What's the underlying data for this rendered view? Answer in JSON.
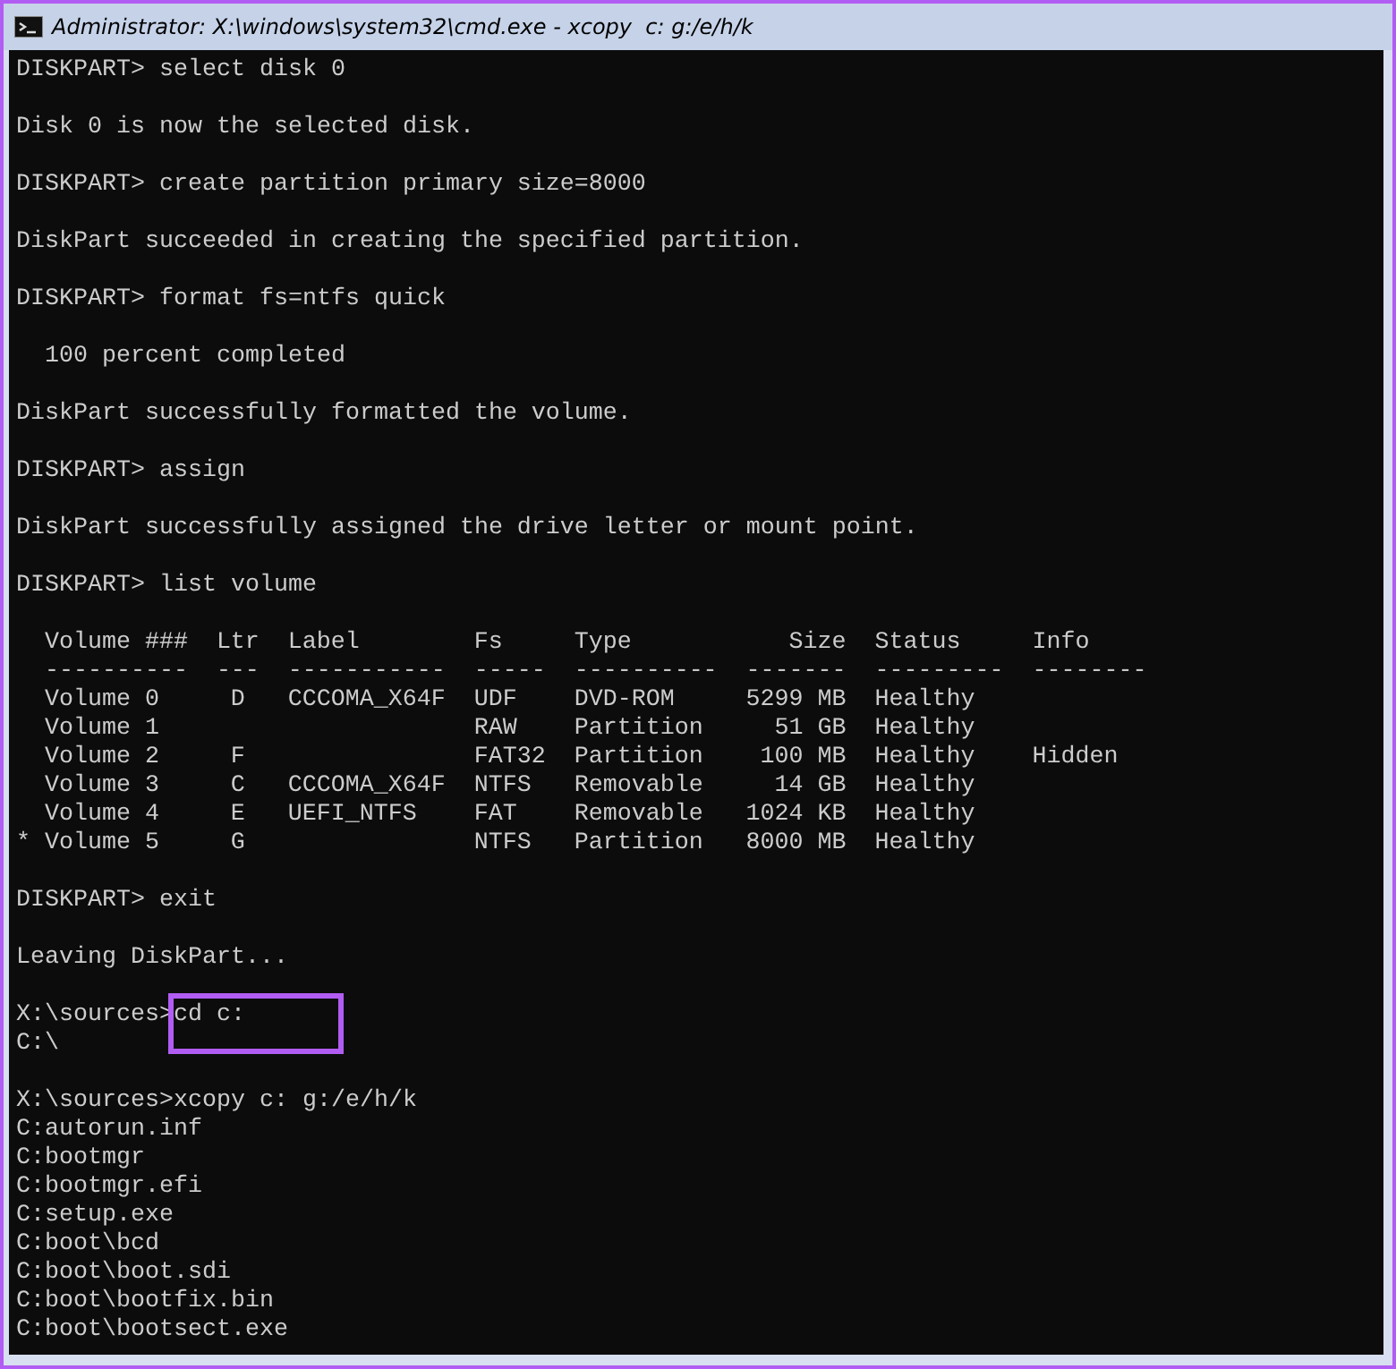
{
  "window": {
    "title": "Administrator: X:\\windows\\system32\\cmd.exe - xcopy  c: g:/e/h/k"
  },
  "console": {
    "blocks": [
      {
        "kind": "text",
        "lines": [
          {
            "text": "DISKPART> select disk 0"
          }
        ]
      },
      {
        "kind": "text",
        "lines": [
          {
            "text": "Disk 0 is now the selected disk."
          }
        ]
      },
      {
        "kind": "text",
        "lines": [
          {
            "text": "DISKPART> create partition primary size=8000"
          }
        ]
      },
      {
        "kind": "text",
        "lines": [
          {
            "text": "DiskPart succeeded in creating the specified partition."
          }
        ]
      },
      {
        "kind": "text",
        "lines": [
          {
            "text": "DISKPART> format fs=ntfs quick"
          }
        ]
      },
      {
        "kind": "text",
        "lines": [
          {
            "text": "  100 percent completed"
          }
        ]
      },
      {
        "kind": "text",
        "lines": [
          {
            "text": "DiskPart successfully formatted the volume."
          }
        ]
      },
      {
        "kind": "text",
        "lines": [
          {
            "text": "DISKPART> assign"
          }
        ]
      },
      {
        "kind": "text",
        "lines": [
          {
            "text": "DiskPart successfully assigned the drive letter or mount point."
          }
        ]
      },
      {
        "kind": "text",
        "lines": [
          {
            "text": "DISKPART> list volume"
          }
        ]
      },
      {
        "kind": "table",
        "columns": [
          "Volume ###",
          "Ltr",
          "Label",
          "Fs",
          "Type",
          "Size",
          "Status",
          "Info"
        ],
        "separators": [
          "----------",
          "---",
          "-----------",
          "-----",
          "----------",
          "-------",
          "---------",
          "--------"
        ],
        "rows": [
          {
            "marker": null,
            "cells": [
              "Volume 0",
              "D",
              "CCCOMA_X64F",
              "UDF",
              "DVD-ROM",
              "5299 MB",
              "Healthy",
              null
            ]
          },
          {
            "marker": null,
            "cells": [
              "Volume 1",
              null,
              null,
              "RAW",
              "Partition",
              "51 GB",
              "Healthy",
              null
            ]
          },
          {
            "marker": null,
            "cells": [
              "Volume 2",
              "F",
              null,
              "FAT32",
              "Partition",
              "100 MB",
              "Healthy",
              "Hidden"
            ]
          },
          {
            "marker": null,
            "cells": [
              "Volume 3",
              "C",
              "CCCOMA_X64F",
              "NTFS",
              "Removable",
              "14 GB",
              "Healthy",
              null
            ]
          },
          {
            "marker": null,
            "cells": [
              "Volume 4",
              "E",
              "UEFI_NTFS",
              "FAT",
              "Removable",
              "1024 KB",
              "Healthy",
              null
            ]
          },
          {
            "marker": "*",
            "cells": [
              "Volume 5",
              "G",
              null,
              "NTFS",
              "Partition",
              "8000 MB",
              "Healthy",
              null
            ]
          }
        ]
      },
      {
        "kind": "text",
        "lines": [
          {
            "text": "DISKPART> exit"
          }
        ]
      },
      {
        "kind": "text",
        "lines": [
          {
            "text": "Leaving DiskPart..."
          }
        ]
      },
      {
        "kind": "text",
        "lines": [
          {
            "prompt": "X:\\sources>",
            "command": "cd c:",
            "highlighted": true
          },
          {
            "text": "C:\\"
          }
        ]
      },
      {
        "kind": "text",
        "lines": [
          {
            "prompt": "X:\\sources>",
            "command": "xcopy c: g:/e/h/k",
            "highlighted": false
          },
          {
            "text": "C:autorun.inf"
          },
          {
            "text": "C:bootmgr"
          },
          {
            "text": "C:bootmgr.efi"
          },
          {
            "text": "C:setup.exe"
          },
          {
            "text": "C:boot\\bcd"
          },
          {
            "text": "C:boot\\boot.sdi"
          },
          {
            "text": "C:boot\\bootfix.bin"
          },
          {
            "text": "C:boot\\bootsect.exe"
          }
        ]
      }
    ]
  }
}
